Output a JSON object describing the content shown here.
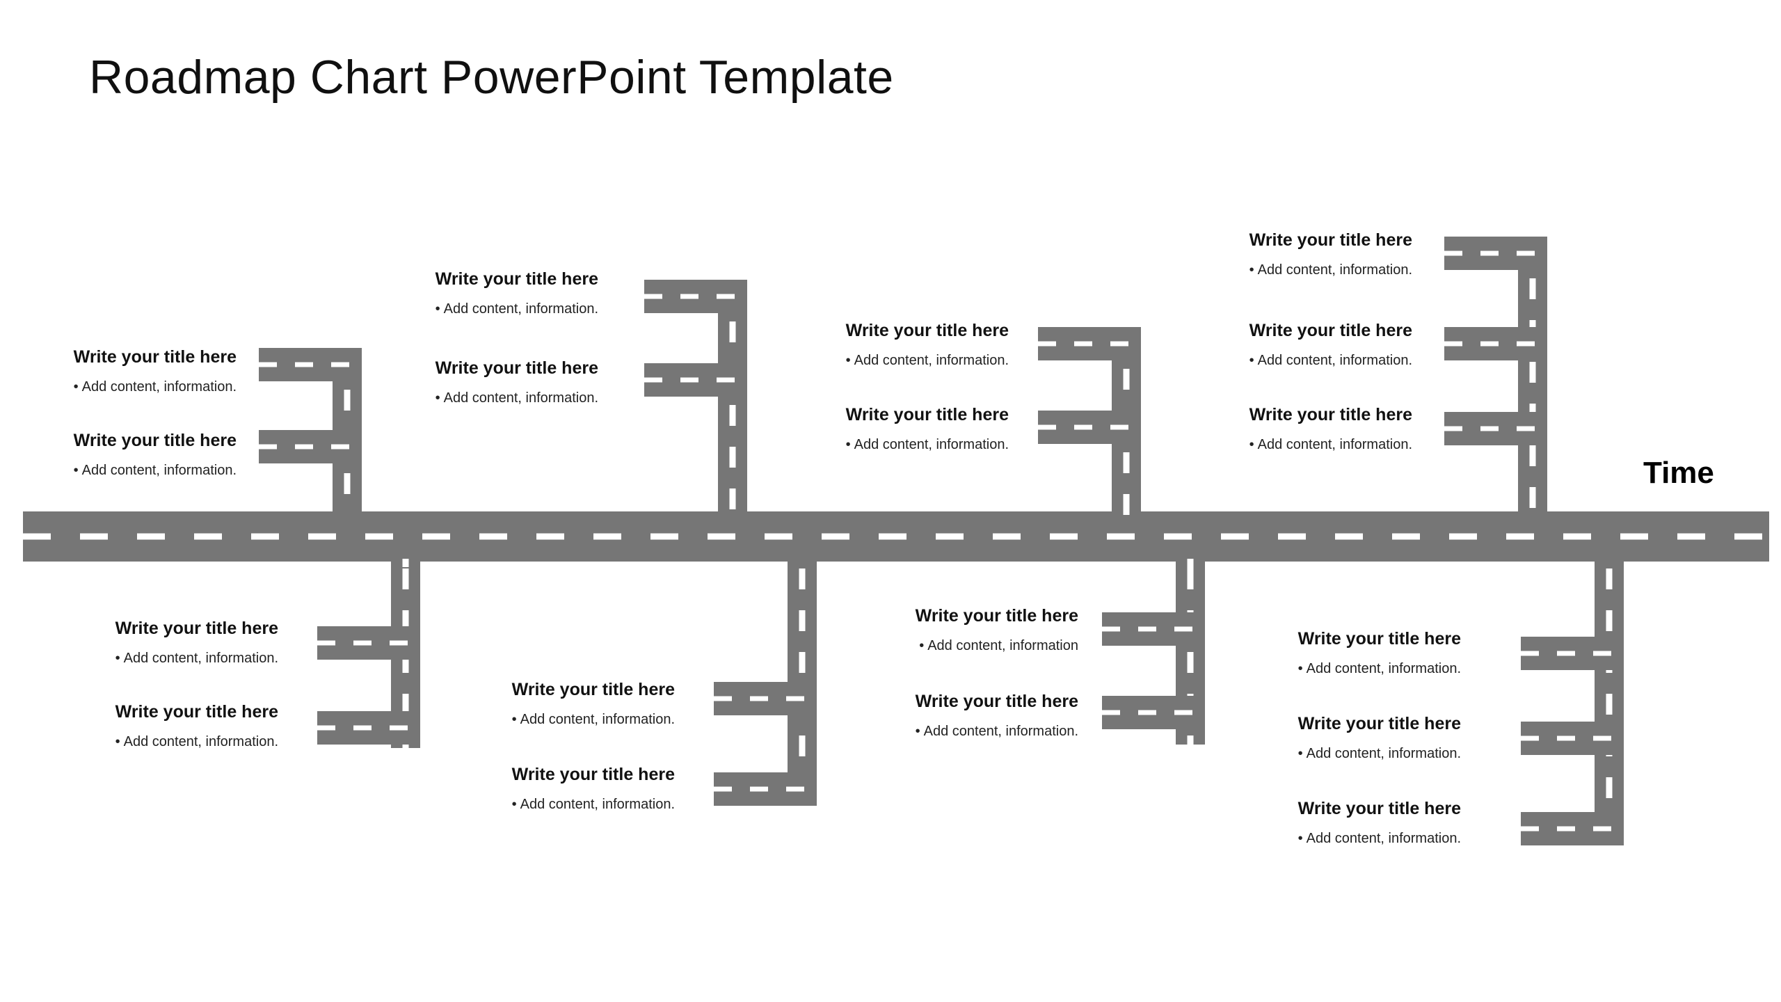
{
  "slide": {
    "title": "Roadmap Chart PowerPoint Template",
    "axis_label": "Time",
    "background_color": "#ffffff",
    "road_color": "#767676",
    "road_marking_color": "#ffffff",
    "text_color": "#111111"
  },
  "bullet_marker": "•",
  "chart_data": {
    "type": "diagram",
    "title": "Roadmap Chart PowerPoint Template",
    "subtype": "road-timeline-roadmap",
    "axis_label": "Time",
    "axis_direction": "left-to-right",
    "milestone_count": 16,
    "branches_above": 8,
    "branches_below": 8
  },
  "milestones": [
    {
      "id": "m1",
      "side": "top",
      "align": "right",
      "title": "Write your title here",
      "bullet": "Add content, information."
    },
    {
      "id": "m2",
      "side": "top",
      "align": "right",
      "title": "Write your title here",
      "bullet": "Add content, information."
    },
    {
      "id": "m3",
      "side": "top",
      "align": "right",
      "title": "Write your title here",
      "bullet": "Add content, information."
    },
    {
      "id": "m4",
      "side": "top",
      "align": "right",
      "title": "Write your title here",
      "bullet": "Add content, information."
    },
    {
      "id": "m5",
      "side": "top",
      "align": "right",
      "title": "Write your title here",
      "bullet": "Add content, information."
    },
    {
      "id": "m6",
      "side": "top",
      "align": "right",
      "title": "Write your title here",
      "bullet": "Add content, information."
    },
    {
      "id": "m7",
      "side": "top",
      "align": "right",
      "title": "Write your title here",
      "bullet": "Add content, information."
    },
    {
      "id": "m8",
      "side": "top",
      "align": "right",
      "title": "Write your title here",
      "bullet": "Add content, information."
    },
    {
      "id": "m9",
      "side": "top",
      "align": "right",
      "title": "Write your title here",
      "bullet": "Add content, information."
    },
    {
      "id": "m10",
      "side": "bottom",
      "align": "right",
      "title": "Write your title here",
      "bullet": "Add content, information."
    },
    {
      "id": "m11",
      "side": "bottom",
      "align": "right",
      "title": "Write your title here",
      "bullet": "Add content, information."
    },
    {
      "id": "m12",
      "side": "bottom",
      "align": "right",
      "title": "Write your title here",
      "bullet": "Add content, information."
    },
    {
      "id": "m13",
      "side": "bottom",
      "align": "right",
      "title": "Write your title here",
      "bullet": "Add content, information."
    },
    {
      "id": "m14",
      "side": "bottom",
      "align": "right",
      "title": "Write your title here",
      "bullet": "Add content, information"
    },
    {
      "id": "m15",
      "side": "bottom",
      "align": "right",
      "title": "Write your title here",
      "bullet": "Add content, information."
    },
    {
      "id": "m16",
      "side": "bottom",
      "align": "right",
      "title": "Write your title here",
      "bullet": "Add content, information."
    },
    {
      "id": "m17",
      "side": "bottom",
      "align": "right",
      "title": "Write your title here",
      "bullet": "Add content, information."
    },
    {
      "id": "m18",
      "side": "bottom",
      "align": "right",
      "title": "Write your title here",
      "bullet": "Add content, information."
    }
  ]
}
